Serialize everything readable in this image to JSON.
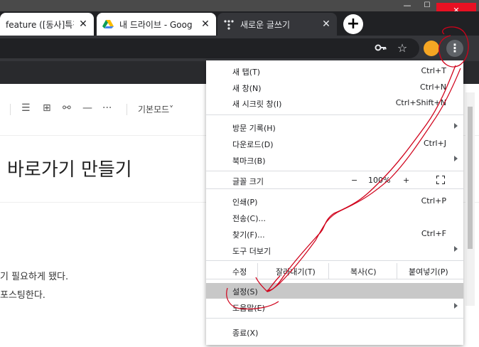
{
  "window": {
    "minimize": "—",
    "maximize": "☐",
    "close": "✕"
  },
  "tabs": [
    {
      "label": "feature ([동사]특징",
      "close": "✕"
    },
    {
      "label": "내 드라이브 - Goog",
      "close": "✕"
    },
    {
      "label": "새로운 글쓰기",
      "close": "✕"
    }
  ],
  "new_tab": "+",
  "toolbar": {
    "menu_icon": "⋮",
    "star": "☆"
  },
  "editor": {
    "mode_label": "기본모드"
  },
  "page": {
    "heading": "바로가기 만들기",
    "line1": "기 필요하게 됐다.",
    "line2": "포스팅한다."
  },
  "menu": {
    "new_tab": {
      "label": "새 탭(T)",
      "shortcut": "Ctrl+T"
    },
    "new_window": {
      "label": "새 창(N)",
      "shortcut": "Ctrl+N"
    },
    "incognito": {
      "label": "새 시크릿 창(I)",
      "shortcut": "Ctrl+Shift+N"
    },
    "history": {
      "label": "방문 기록(H)"
    },
    "downloads": {
      "label": "다운로드(D)",
      "shortcut": "Ctrl+J"
    },
    "bookmarks": {
      "label": "북마크(B)"
    },
    "zoom": {
      "label": "글꼴 크기",
      "minus": "−",
      "value": "100%",
      "plus": "+"
    },
    "print": {
      "label": "인쇄(P)",
      "shortcut": "Ctrl+P"
    },
    "cast": {
      "label": "전송(C)..."
    },
    "find": {
      "label": "찾기(F)...",
      "shortcut": "Ctrl+F"
    },
    "more_tools": {
      "label": "도구 더보기"
    },
    "edit": {
      "label": "수정",
      "cut": "잘라내기(T)",
      "copy": "복사(C)",
      "paste": "붙여넣기(P)"
    },
    "settings": {
      "label": "설정(S)"
    },
    "help": {
      "label": "도움말(E)"
    },
    "exit": {
      "label": "종료(X)"
    }
  },
  "colors": {
    "accent_annotation": "#d0021b",
    "highlight": "#c8c8c8",
    "close_red": "#e81123"
  }
}
